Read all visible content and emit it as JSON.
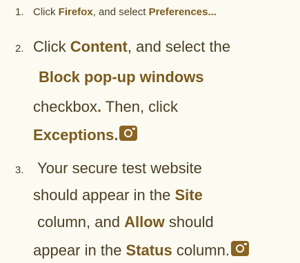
{
  "steps": [
    {
      "number": "1.",
      "parts": {
        "t1": "Click ",
        "b1": "Firefox",
        "t2": ", and select ",
        "b2": "Preferences..."
      }
    },
    {
      "number": "2.",
      "parts": {
        "t1": "Click ",
        "b1": "Content",
        "t2": ", and select the",
        "b2": "Block pop-up windows",
        "t3": "checkbox",
        "b3": ".",
        "t4": " Then, click",
        "b4": "Exceptions."
      },
      "icon": "camera-icon"
    },
    {
      "number": "3.",
      "parts": {
        "t1": "Your secure test website",
        "t2": "should appear in the ",
        "b1": "Site",
        "b2": "column",
        "t3": ", and ",
        "b3": "Allow",
        "t4": " should",
        "t5": "appear in the ",
        "b4": "Status",
        "t6": " column."
      },
      "icon": "camera-icon"
    }
  ]
}
